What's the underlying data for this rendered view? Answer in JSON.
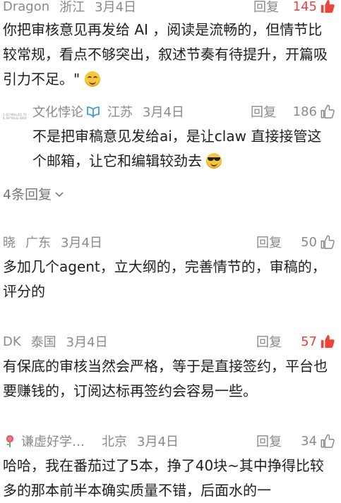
{
  "comments": [
    {
      "nick": "Dragon",
      "region": "浙江",
      "date": "3月4日",
      "reply": "回复",
      "likes": "145",
      "liked": true,
      "text": "你把审核意见再发给 AI ，阅读是流畅的，但情节比较常规，看点不够突出，叙述节奏有待提升，开篇吸引力不足。\"",
      "emoji": "grin-emoji"
    },
    {
      "nick": "文化悖论",
      "region": "江苏",
      "date": "3月4日",
      "reply": "回复",
      "likes": "186",
      "liked": false,
      "avatar_text": "1.61*86x=61.76 0.89*86=0.0858",
      "text": "不是把审稿意见发给ai，是让claw 直接接管这个邮箱，让它和编辑较劲去",
      "emoji": "sunglasses-emoji"
    },
    {
      "nick": "晓",
      "region": "广东",
      "date": "3月4日",
      "reply": "回复",
      "likes": "50",
      "liked": false,
      "text": "多加几个agent，立大纲的，完善情节的，审稿的，评分的"
    },
    {
      "nick": "DK",
      "region": "泰国",
      "date": "3月4日",
      "reply": "回复",
      "likes": "57",
      "liked": true,
      "text": "有保底的审核当然会严格，等于是直接签约，平台也要赚钱的，订阅达标再签约会容易一些。"
    },
    {
      "nick": "谦虚好学…",
      "region": "北京",
      "date": "3月4日",
      "reply": "回复",
      "likes": "34",
      "liked": false,
      "text": "哈哈，我在番茄过了5本，挣了40块~其中挣得比较多的那本前半本确实质量不错，后面水的一"
    }
  ],
  "more_replies": "4条回复",
  "colors": {
    "liked": "#e8443a",
    "meta": "#8a8a8a",
    "verified": "#3aa0d8"
  }
}
